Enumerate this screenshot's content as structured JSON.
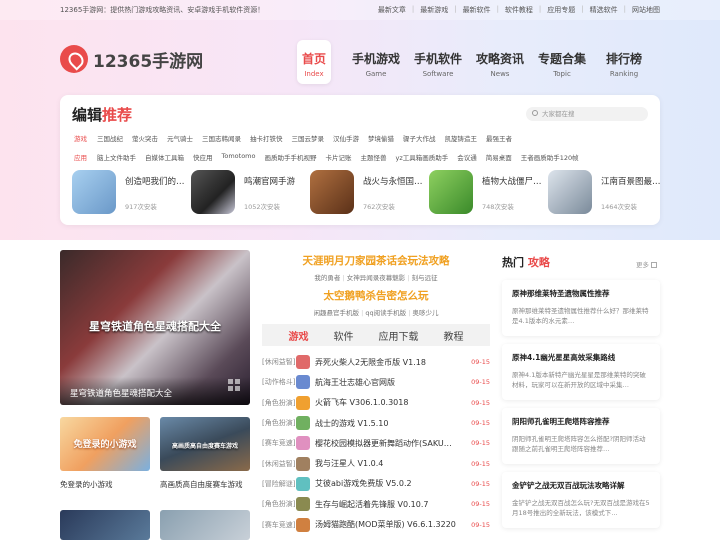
{
  "topbar": {
    "tagline": "12365手游网：提供热门游戏攻略资讯、安卓游戏手机软件资源！",
    "links": [
      "最新文章",
      "最新游戏",
      "最新软件",
      "软件教程",
      "应用专题",
      "精选软件",
      "网站地图"
    ]
  },
  "logo": {
    "name": "12365手游网"
  },
  "nav": [
    {
      "title": "首页",
      "sub": "Index"
    },
    {
      "title": "手机游戏",
      "sub": "Game"
    },
    {
      "title": "手机软件",
      "sub": "Software"
    },
    {
      "title": "攻略资讯",
      "sub": "News"
    },
    {
      "title": "专题合集",
      "sub": "Topic"
    },
    {
      "title": "排行榜",
      "sub": "Ranking"
    }
  ],
  "editor": {
    "title_a": "编辑",
    "title_b": "推荐",
    "search_placeholder": "大家都在搜",
    "game_label": "游戏",
    "game_tags": [
      "三国战纪",
      "萤火突击",
      "元气骑士",
      "三国志韩闻录",
      "抽卡打铁快",
      "三国云梦录",
      "汉仙手游",
      "梦境偷猎",
      "骤子大作战",
      "凯旋铸造王",
      "最强王者"
    ],
    "app_label": "应用",
    "app_tags": [
      "脑上文件助手",
      "自媒体工具箱",
      "快应用",
      "Tomotomo",
      "画质助手手机视野",
      "卡片记账",
      "主题怪兽",
      "yz工具箱画质助手",
      "会议通",
      "简易桌面",
      "王者画质助手120帧"
    ],
    "apps": [
      {
        "name": "创造吧我们的…",
        "count": "917次安装",
        "color": "#8ab7e0"
      },
      {
        "name": "鸣潮官网手游",
        "count": "1052次安装",
        "color": "#3a3a48"
      },
      {
        "name": "战火与永恒国…",
        "count": "762次安装",
        "color": "#7a4a2a"
      },
      {
        "name": "植物大战僵尸…",
        "count": "748次安装",
        "color": "#5fae3a"
      },
      {
        "name": "江南百景图最…",
        "count": "1464次安装",
        "color": "#a9b8c8"
      }
    ]
  },
  "feature": {
    "overlay": "星穹铁道角色星魂搭配大全",
    "caption": "星穹铁道角色星魂搭配大全"
  },
  "thumbs": [
    {
      "caption": "免登录的小游戏",
      "overlay": "免登录的小游戏"
    },
    {
      "caption": "高画质高自由度赛车游戏",
      "overlay": "高画质高自由度赛车游戏"
    }
  ],
  "headlines": {
    "h1": "天涯明月刀家园茶话会玩法攻略",
    "sub1": [
      "我的勇者",
      "女神异闻录夜幕魅影",
      "刻与远征"
    ],
    "h2": "太空鹅鸭杀告密怎么玩",
    "sub2": [
      "闲趣悬官手机版",
      "qq阅读手机版",
      "奥哆少儿"
    ]
  },
  "tabs": [
    "游戏",
    "软件",
    "应用下载",
    "教程"
  ],
  "list": [
    {
      "cat": "[休闲益智]",
      "name": "弄死火柴人2无限金币版 V1.18",
      "date": "09-15",
      "color": "#e06a6a"
    },
    {
      "cat": "[动作格斗]",
      "name": "航海王壮志雄心官网版",
      "date": "09-15",
      "color": "#6a8ad0"
    },
    {
      "cat": "[角色扮演]",
      "name": "火箭飞车 V306.1.0.3018",
      "date": "09-15",
      "color": "#f0a030"
    },
    {
      "cat": "[角色扮演]",
      "name": "战士的游戏 V1.5.10",
      "date": "09-15",
      "color": "#70b060"
    },
    {
      "cat": "[赛车竞速]",
      "name": "樱花校园模拟器更新舞蹈动作(SAKU…",
      "date": "09-15",
      "color": "#e090c0"
    },
    {
      "cat": "[休闲益智]",
      "name": "我与汪星人 V1.0.4",
      "date": "09-15",
      "color": "#a08060"
    },
    {
      "cat": "[冒险解谜]",
      "name": "艾彼abi游戏免费版 V5.0.2",
      "date": "09-15",
      "color": "#60c0c0"
    },
    {
      "cat": "[角色扮演]",
      "name": "生存与崛起活着先锋服 V0.10.7",
      "date": "09-15",
      "color": "#8a8a50"
    },
    {
      "cat": "[赛车竞速]",
      "name": "汤姆猫跑酷(MOD菜单版) V6.6.1.3220",
      "date": "09-15",
      "color": "#d08040"
    }
  ],
  "hot": {
    "title_a": "热门",
    "title_b": "攻略",
    "more": "更多",
    "cards": [
      {
        "title": "原神那维莱特圣遗物属性推荐",
        "desc": "原神那维莱特圣遗物属性推荐什么好？那维莱特是4.1版本的水元素…"
      },
      {
        "title": "原神4.1幽光星星高效采集路线",
        "desc": "原神4.1版本新特产幽光星星是那维莱特的突破材料，玩家可以在新开放的区域中采集…"
      },
      {
        "title": "阴阳师孔雀明王爬塔阵容推荐",
        "desc": "阴阳师孔雀明王爬塔阵容怎么搭配?阴阳师活动跟随之前孔雀明王爬塔阵容推荐…"
      },
      {
        "title": "金铲铲之战无双百战玩法攻略详解",
        "desc": "金铲铲之战无双百战怎么玩?无双百战是游戏在5月18号推出的全新玩法，该模式下…"
      }
    ]
  }
}
